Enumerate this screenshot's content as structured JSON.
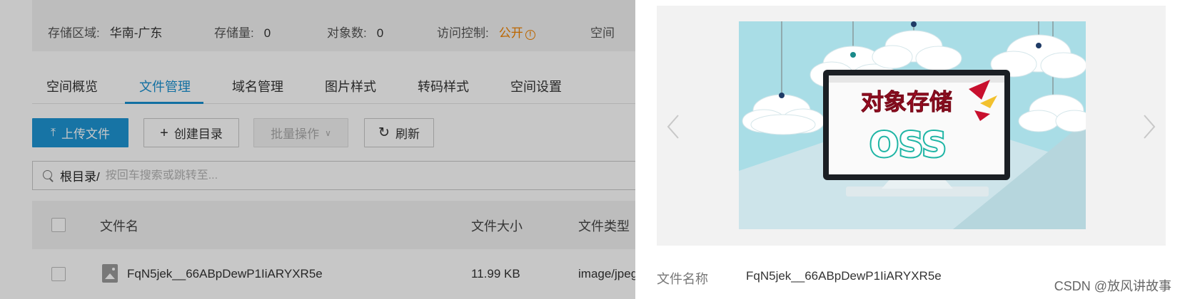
{
  "bucket_info": {
    "region_label": "存储区域:",
    "region_value": "华南-广东",
    "storage_label": "存储量:",
    "storage_value": "0",
    "objects_label": "对象数:",
    "objects_value": "0",
    "access_label": "访问控制:",
    "access_value": "公开",
    "truncated_label": "空间"
  },
  "tabs": [
    "空间概览",
    "文件管理",
    "域名管理",
    "图片样式",
    "转码样式",
    "空间设置"
  ],
  "active_tab": 1,
  "toolbar": {
    "upload_label": "上传文件",
    "create_dir_label": "创建目录",
    "batch_label": "批量操作",
    "refresh_label": "刷新"
  },
  "path": {
    "root": "根目录/",
    "placeholder": "按回车搜索或跳转至..."
  },
  "table": {
    "columns": [
      "文件名",
      "文件大小",
      "文件类型"
    ],
    "rows": [
      {
        "name": "FqN5jek__66ABpDewP1IiARYXR5e",
        "size": "11.99 KB",
        "type": "image/jpeg"
      }
    ]
  },
  "drawer": {
    "preview_image_text": {
      "title": "对象存储",
      "subtitle": "OSS"
    },
    "file_name_label": "文件名称",
    "file_name_value": "FqN5jek__66ABpDewP1IiARYXR5e"
  },
  "watermark": "CSDN @放风讲故事",
  "colors": {
    "accent": "#1890d0",
    "primary_button": "#1e95d4",
    "warning": "#f08300",
    "preview_sky": "#a9dde6",
    "preview_title_red": "#c8102e",
    "preview_oss_teal": "#1fb5a5"
  },
  "icons": {
    "upload": "upload-icon",
    "create": "plus-icon",
    "batch_dropdown": "chevron-down-icon",
    "refresh": "refresh-icon",
    "search": "search-icon",
    "file": "image-file-icon",
    "prev": "chevron-left-icon",
    "next": "chevron-right-icon",
    "warning": "warning-circle-icon"
  }
}
